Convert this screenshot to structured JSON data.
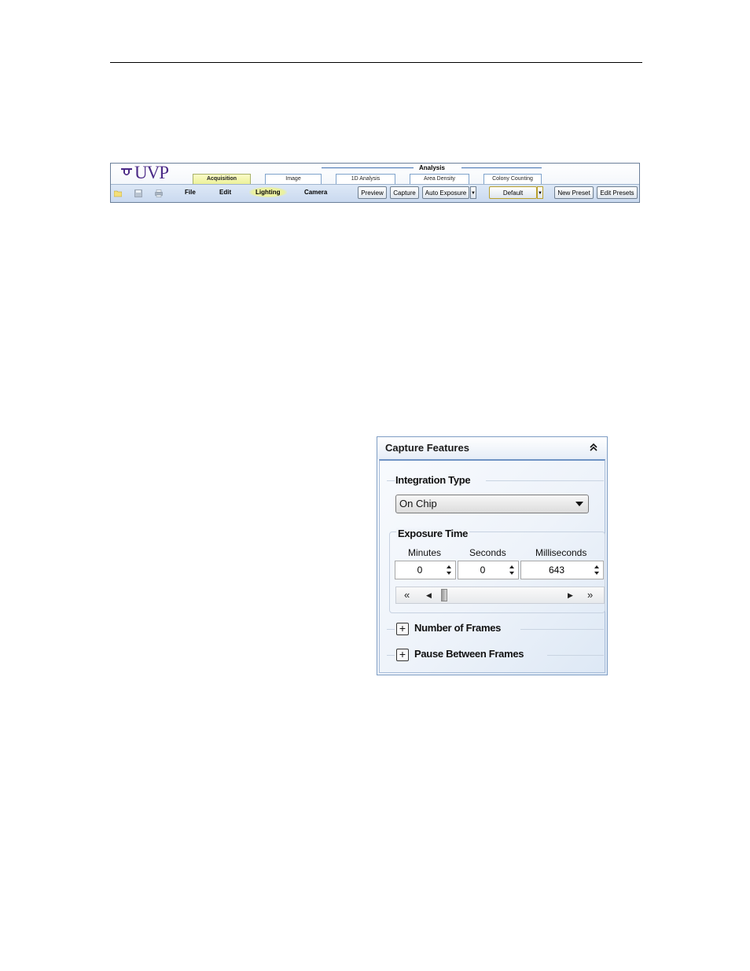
{
  "ribbon": {
    "logo_text": "UVP",
    "analysis_label": "Analysis",
    "tabs": [
      {
        "label": "Acquisition",
        "active": true
      },
      {
        "label": "Image",
        "active": false
      },
      {
        "label": "1D Analysis",
        "active": false
      },
      {
        "label": "Area Density",
        "active": false
      },
      {
        "label": "Colony Counting",
        "active": false
      }
    ],
    "menus": {
      "file": "File",
      "edit": "Edit",
      "lighting": "Lighting",
      "camera": "Camera"
    },
    "buttons": {
      "preview": "Preview",
      "capture": "Capture",
      "auto_exposure": "Auto Exposure",
      "preset": "Default",
      "new_preset": "New Preset",
      "edit_presets": "Edit Presets"
    },
    "colors": {
      "brand": "#4b2a87",
      "active_tab": "#ecf199",
      "bar": "#c9d9ef"
    }
  },
  "panel": {
    "title": "Capture Features",
    "collapse_icon": "double-chevron-up-icon",
    "integration": {
      "title": "Integration Type",
      "selected": "On Chip"
    },
    "exposure": {
      "title": "Exposure Time",
      "minutes_label": "Minutes",
      "seconds_label": "Seconds",
      "milliseconds_label": "Milliseconds",
      "minutes": "0",
      "seconds": "0",
      "milliseconds": "643",
      "slider_fraction": 0.02
    },
    "frames": {
      "title": "Number of Frames",
      "expand_icon": "plus-icon"
    },
    "pause": {
      "title": "Pause Between Frames",
      "expand_icon": "plus-icon"
    }
  }
}
